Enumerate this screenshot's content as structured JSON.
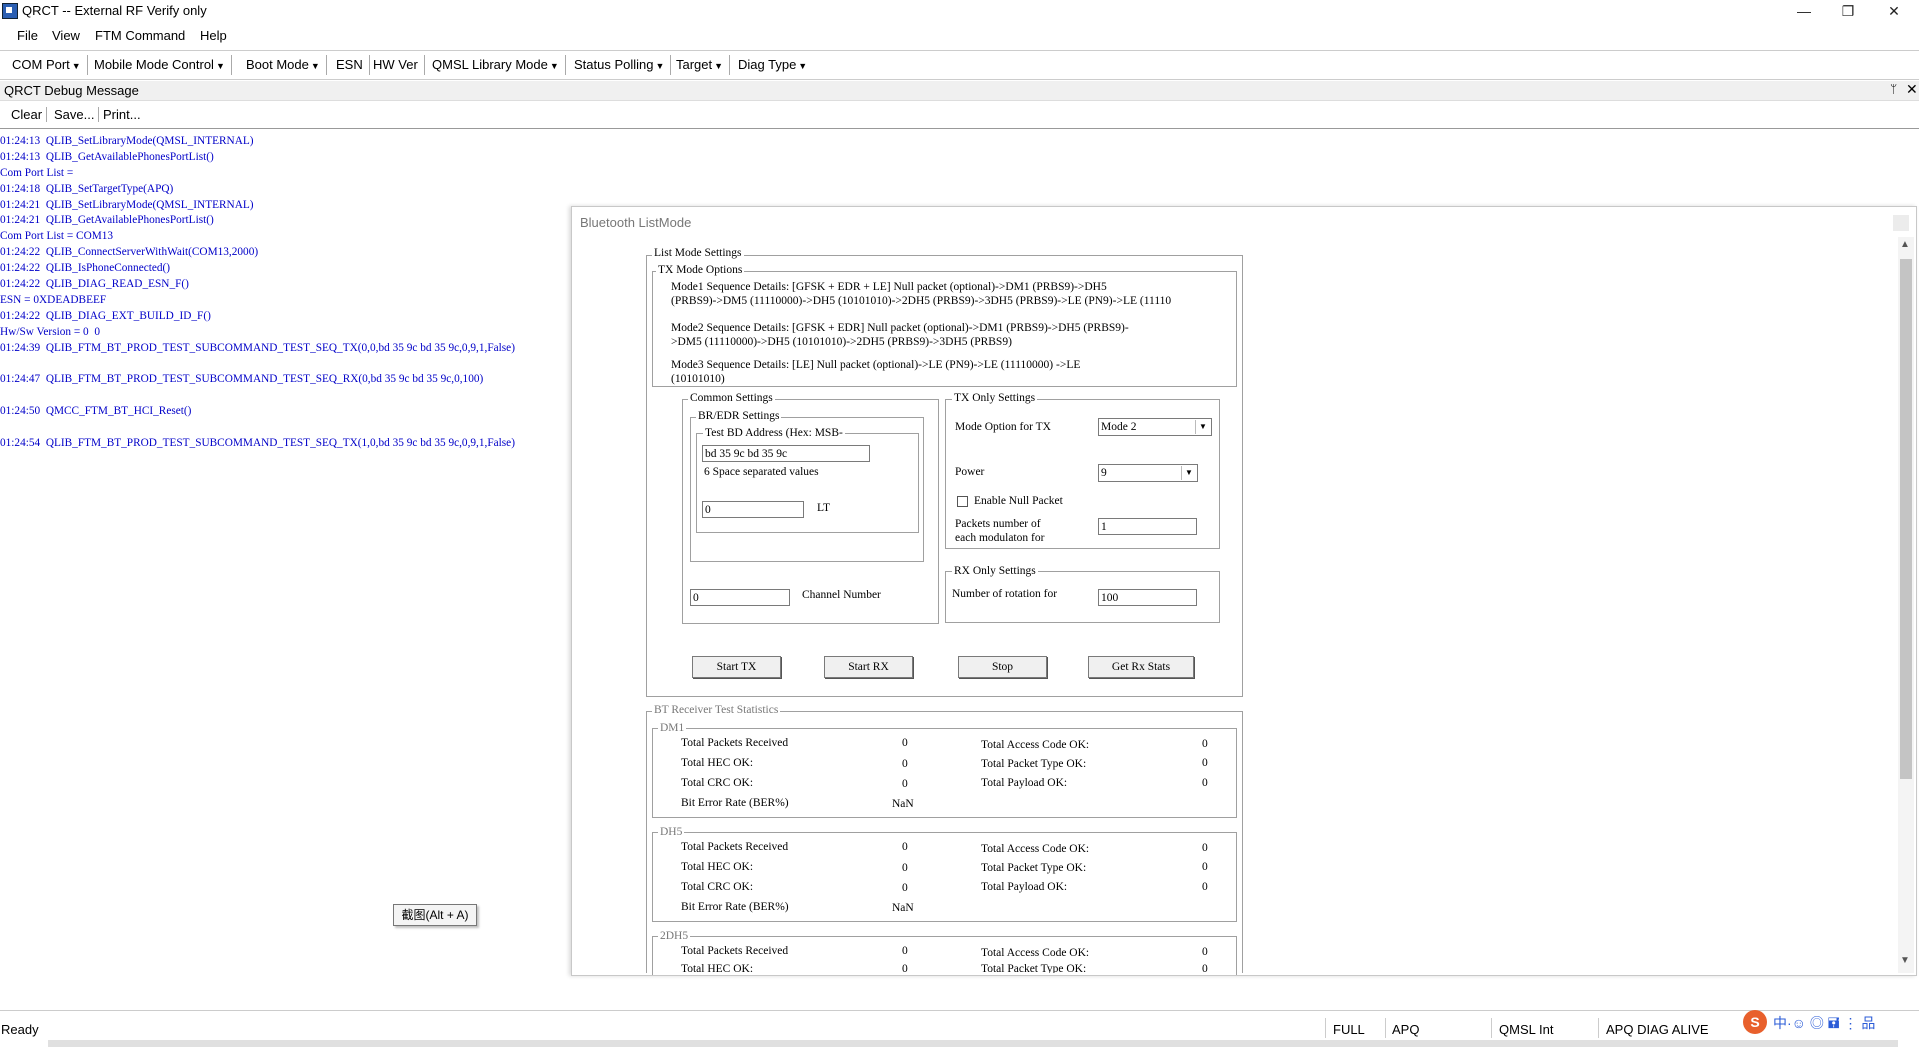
{
  "window": {
    "title": "QRCT -- External RF Verify only",
    "minimize": "—",
    "restore": "❐",
    "close": "✕"
  },
  "menu": [
    "File",
    "View",
    "FTM Command",
    "Help"
  ],
  "toolbar": [
    {
      "label": "COM Port",
      "dropdown": true
    },
    {
      "label": "Mobile Mode Control",
      "dropdown": true
    },
    {
      "label": "Boot Mode",
      "dropdown": true
    },
    {
      "label": "ESN",
      "dropdown": false
    },
    {
      "label": "HW Ver",
      "dropdown": false
    },
    {
      "label": "QMSL Library Mode",
      "dropdown": true
    },
    {
      "label": "Status Polling",
      "dropdown": true
    },
    {
      "label": "Target",
      "dropdown": true
    },
    {
      "label": "Diag Type",
      "dropdown": true
    }
  ],
  "debug_panel": {
    "title": "QRCT Debug Message",
    "pin": "ᛘ",
    "close": "✕",
    "buttons": [
      "Clear",
      "Save...",
      "Print..."
    ],
    "log": [
      "01:24:13  QLIB_SetLibraryMode(QMSL_INTERNAL)",
      "01:24:13  QLIB_GetAvailablePhonesPortList()",
      "Com Port List =",
      "01:24:18  QLIB_SetTargetType(APQ)",
      "01:24:21  QLIB_SetLibraryMode(QMSL_INTERNAL)",
      "01:24:21  QLIB_GetAvailablePhonesPortList()",
      "Com Port List = COM13",
      "01:24:22  QLIB_ConnectServerWithWait(COM13,2000)",
      "01:24:22  QLIB_IsPhoneConnected()",
      "01:24:22  QLIB_DIAG_READ_ESN_F()",
      "ESN = 0XDEADBEEF",
      "01:24:22  QLIB_DIAG_EXT_BUILD_ID_F()",
      "Hw/Sw Version = 0  0",
      "01:24:39  QLIB_FTM_BT_PROD_TEST_SUBCOMMAND_TEST_SEQ_TX(0,0,bd 35 9c bd 35 9c,0,9,1,False)",
      "",
      "01:24:47  QLIB_FTM_BT_PROD_TEST_SUBCOMMAND_TEST_SEQ_RX(0,bd 35 9c bd 35 9c,0,100)",
      "",
      "01:24:50  QMCC_FTM_BT_HCI_Reset()",
      "",
      "01:24:54  QLIB_FTM_BT_PROD_TEST_SUBCOMMAND_TEST_SEQ_TX(1,0,bd 35 9c bd 35 9c,0,9,1,False)"
    ]
  },
  "tooltip": "截图(Alt + A)",
  "dialog": {
    "title": "Bluetooth ListMode",
    "list_mode_settings": "List Mode Settings",
    "tx_mode_options": "TX Mode Options",
    "mode1_line1": "Mode1 Sequence Details: [GFSK + EDR + LE] Null packet (optional)->DM1 (PRBS9)->DH5",
    "mode1_line2": "(PRBS9)->DM5 (11110000)->DH5 (10101010)->2DH5 (PRBS9)->3DH5 (PRBS9)->LE (PN9)->LE (11110",
    "mode2_line1": "Mode2 Sequence Details: [GFSK + EDR] Null packet (optional)->DM1 (PRBS9)->DH5 (PRBS9)-",
    "mode2_line2": ">DM5 (11110000)->DH5 (10101010)->2DH5 (PRBS9)->3DH5 (PRBS9)",
    "mode3_line1": "Mode3 Sequence Details: [LE] Null packet (optional)->LE (PN9)->LE (11110000) ->LE",
    "mode3_line2": "(10101010)",
    "common_settings": "Common Settings",
    "br_edr_settings": "BR/EDR Settings",
    "test_bd_address": "Test BD Address (Hex: MSB-",
    "bd_address_value": "bd 35 9c bd 35 9c",
    "bd_hint": "6 Space separated values",
    "lt_value": "0",
    "lt_label": "LT",
    "channel_value": "0",
    "channel_label": "Channel Number",
    "tx_only_settings": "TX Only Settings",
    "mode_option_label": "Mode Option for TX",
    "mode_option_value": "Mode 2",
    "power_label": "Power",
    "power_value": "9",
    "null_packet_label": "Enable Null Packet",
    "null_packet_checked": false,
    "packets_label_1": "Packets number of",
    "packets_label_2": "each modulaton for",
    "packets_value": "1",
    "rx_only_settings": "RX Only Settings",
    "rotation_label": "Number of rotation for",
    "rotation_value": "100",
    "buttons": {
      "start_tx": "Start TX",
      "start_rx": "Start RX",
      "stop": "Stop",
      "get_rx_stats": "Get Rx Stats"
    },
    "stats_title": "BT Receiver Test Statistics",
    "stats_groups": [
      {
        "name": "DM1",
        "total_packets_label": "Total Packets Received",
        "total_packets": "0",
        "hec_label": "Total HEC OK:",
        "hec": "0",
        "crc_label": "Total CRC OK:",
        "crc": "0",
        "ber_label": "Bit Error Rate (BER%)",
        "ber": "NaN",
        "access_label": "Total Access Code OK:",
        "access": "0",
        "ptype_label": "Total Packet Type OK:",
        "ptype": "0",
        "payload_label": "Total Payload OK:",
        "payload": "0"
      },
      {
        "name": "DH5",
        "total_packets_label": "Total Packets Received",
        "total_packets": "0",
        "hec_label": "Total HEC OK:",
        "hec": "0",
        "crc_label": "Total CRC OK:",
        "crc": "0",
        "ber_label": "Bit Error Rate (BER%)",
        "ber": "NaN",
        "access_label": "Total Access Code OK:",
        "access": "0",
        "ptype_label": "Total Packet Type OK:",
        "ptype": "0",
        "payload_label": "Total Payload OK:",
        "payload": "0"
      },
      {
        "name": "2DH5",
        "total_packets_label": "Total Packets Received",
        "total_packets": "0",
        "hec_label": "Total HEC OK:",
        "hec": "0",
        "access_label": "Total Access Code OK:",
        "access": "0",
        "ptype_label": "Total Packet Type OK:",
        "ptype": "0"
      }
    ]
  },
  "statusbar": {
    "left": "Ready",
    "fields": [
      "FULL",
      "APQ",
      "QMSL Int",
      "APQ DIAG ALIVE"
    ]
  },
  "watermark": {
    "badge": "S",
    "text": "中·☺ ◎ 🖬 ⋮ 品"
  }
}
